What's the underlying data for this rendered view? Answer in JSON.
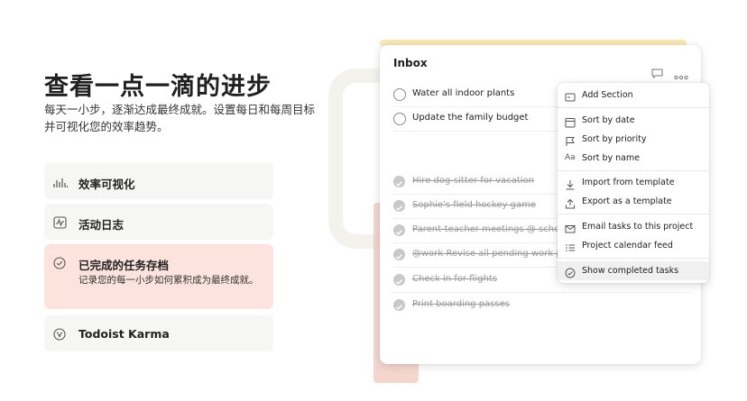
{
  "hero": {
    "headline": "查看一点一滴的进步",
    "subtitle": "每天一小步，逐渐达成最终成就。设置每日和每周目标并可视化您的效率趋势。"
  },
  "features": [
    {
      "label": "效率可视化",
      "icon": "bar-chart-icon"
    },
    {
      "label": "活动日志",
      "icon": "activity-icon"
    },
    {
      "label": "已完成的任务存档",
      "description": "记录您的每一小步如何累积成为最终成就。",
      "icon": "check-circle-icon",
      "active": true
    },
    {
      "label": "Todoist Karma",
      "icon": "karma-icon"
    }
  ],
  "inbox": {
    "title": "Inbox",
    "open_tasks": [
      "Water all indoor plants",
      "Update the family budget"
    ],
    "completed_tasks": [
      "Hire dog-sitter for vacation",
      "Sophie's field hockey game",
      "Parent-teacher meetings @ school",
      "@work Revise all pending work projects",
      "Check in for flights",
      "Print boarding passes"
    ]
  },
  "menu": {
    "items": [
      {
        "label": "Add Section",
        "icon": "section-icon"
      },
      {
        "label": "Sort by date",
        "icon": "calendar-icon"
      },
      {
        "label": "Sort by priority",
        "icon": "flag-icon"
      },
      {
        "label": "Sort by name",
        "icon": "text-icon"
      },
      {
        "label": "Import from template",
        "icon": "import-icon"
      },
      {
        "label": "Export as a template",
        "icon": "export-icon"
      },
      {
        "label": "Email tasks to this project",
        "icon": "email-icon"
      },
      {
        "label": "Project calendar feed",
        "icon": "list-icon"
      },
      {
        "label": "Show completed tasks",
        "icon": "check-circle-icon",
        "highlighted": true
      }
    ]
  },
  "colors": {
    "active_feature_bg": "#fde3de",
    "feature_bg": "#f6f6f4",
    "accent_yellow": "#f7e2a6"
  }
}
